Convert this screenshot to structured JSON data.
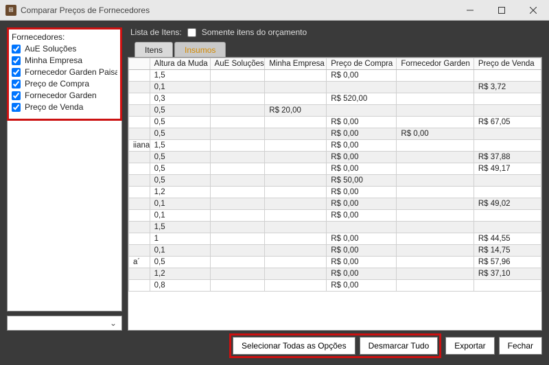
{
  "window": {
    "title": "Comparar Preços de Fornecedores"
  },
  "suppliers": {
    "label": "Fornecedores:",
    "items": [
      {
        "label": "AuE Soluções"
      },
      {
        "label": "Minha Empresa"
      },
      {
        "label": "Fornecedor Garden Paisagis"
      },
      {
        "label": "Preço de Compra"
      },
      {
        "label": "Fornecedor Garden"
      },
      {
        "label": "Preço de Venda"
      }
    ]
  },
  "itemlist": {
    "label": "Lista de Itens:",
    "only_budget_label": "Somente itens do orçamento"
  },
  "tabs": {
    "itens": "Itens",
    "insumos": "Insumos"
  },
  "grid": {
    "headers": {
      "handle": "",
      "altura": "Altura da Muda",
      "aue": "AuE Soluções",
      "minha": "Minha Empresa",
      "compra": "Preço de Compra",
      "garden": "Fornecedor Garden",
      "venda": "Preço de Venda"
    },
    "rows": [
      {
        "h": "",
        "alt": "1,5",
        "a": "",
        "b": "",
        "c": "R$ 0,00",
        "d": "",
        "e": ""
      },
      {
        "h": "",
        "alt": "0,1",
        "a": "",
        "b": "",
        "c": "",
        "d": "",
        "e": "R$ 3,72"
      },
      {
        "h": "",
        "alt": "0,3",
        "a": "",
        "b": "",
        "c": "R$ 520,00",
        "d": "",
        "e": ""
      },
      {
        "h": "",
        "alt": "0,5",
        "a": "",
        "b": "R$ 20,00",
        "c": "",
        "d": "",
        "e": ""
      },
      {
        "h": "",
        "alt": "0,5",
        "a": "",
        "b": "",
        "c": "R$ 0,00",
        "d": "",
        "e": "R$ 67,05"
      },
      {
        "h": "",
        "alt": "0,5",
        "a": "",
        "b": "",
        "c": "R$ 0,00",
        "d": "R$ 0,00",
        "e": ""
      },
      {
        "h": "iiana",
        "alt": "1,5",
        "a": "",
        "b": "",
        "c": "R$ 0,00",
        "d": "",
        "e": ""
      },
      {
        "h": "",
        "alt": "0,5",
        "a": "",
        "b": "",
        "c": "R$ 0,00",
        "d": "",
        "e": "R$ 37,88"
      },
      {
        "h": "",
        "alt": "0,5",
        "a": "",
        "b": "",
        "c": "R$ 0,00",
        "d": "",
        "e": "R$ 49,17"
      },
      {
        "h": "",
        "alt": "0,5",
        "a": "",
        "b": "",
        "c": "R$ 50,00",
        "d": "",
        "e": ""
      },
      {
        "h": "",
        "alt": "1,2",
        "a": "",
        "b": "",
        "c": "R$ 0,00",
        "d": "",
        "e": ""
      },
      {
        "h": "",
        "alt": "0,1",
        "a": "",
        "b": "",
        "c": "R$ 0,00",
        "d": "",
        "e": "R$ 49,02"
      },
      {
        "h": "",
        "alt": "0,1",
        "a": "",
        "b": "",
        "c": "R$ 0,00",
        "d": "",
        "e": ""
      },
      {
        "h": "",
        "alt": "1,5",
        "a": "",
        "b": "",
        "c": "",
        "d": "",
        "e": ""
      },
      {
        "h": "",
        "alt": "1",
        "a": "",
        "b": "",
        "c": "R$ 0,00",
        "d": "",
        "e": "R$ 44,55"
      },
      {
        "h": "",
        "alt": "0,1",
        "a": "",
        "b": "",
        "c": "R$ 0,00",
        "d": "",
        "e": "R$ 14,75"
      },
      {
        "h": "a´",
        "alt": "0,5",
        "a": "",
        "b": "",
        "c": "R$ 0,00",
        "d": "",
        "e": "R$ 57,96"
      },
      {
        "h": "",
        "alt": "1,2",
        "a": "",
        "b": "",
        "c": "R$ 0,00",
        "d": "",
        "e": "R$ 37,10"
      },
      {
        "h": "",
        "alt": "0,8",
        "a": "",
        "b": "",
        "c": "R$ 0,00",
        "d": "",
        "e": ""
      }
    ]
  },
  "buttons": {
    "select_all": "Selecionar Todas as Opções",
    "deselect_all": "Desmarcar Tudo",
    "export": "Exportar",
    "close": "Fechar"
  }
}
